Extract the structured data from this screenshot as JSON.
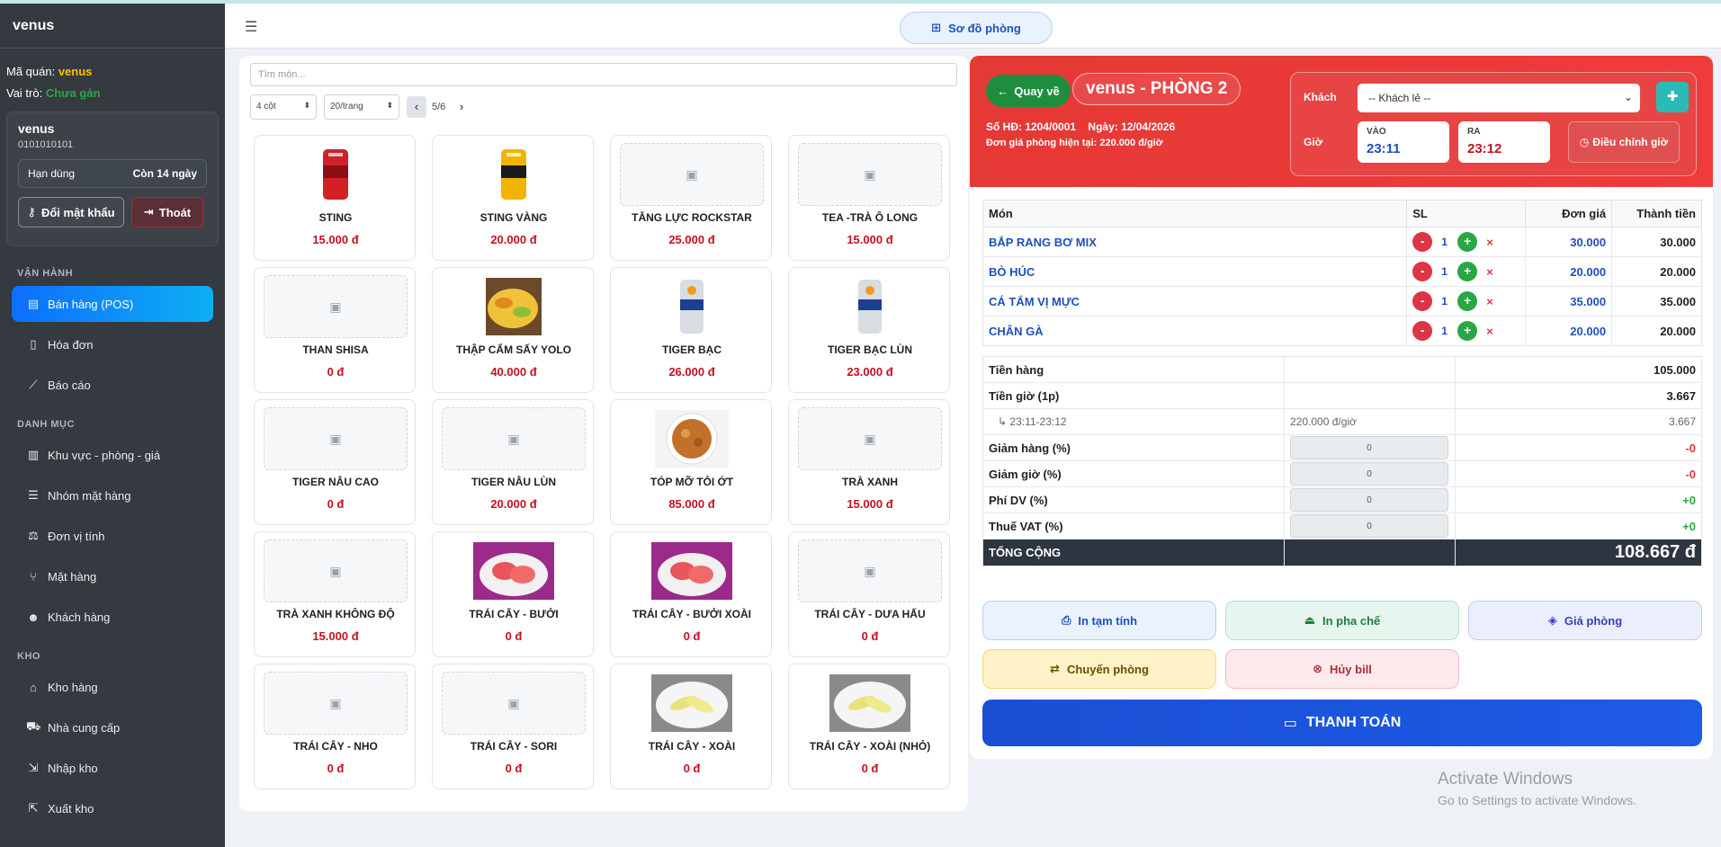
{
  "sidebar": {
    "brand": "venus",
    "shop_code_label": "Mã quán:",
    "shop_code": "venus",
    "role_label": "Vai trò:",
    "role": "Chưa gán",
    "account": {
      "name": "venus",
      "code": "0101010101",
      "expiry_label": "Hạn dùng",
      "expiry_value": "Còn 14 ngày",
      "change_password": "Đổi mật khẩu",
      "logout": "Thoát"
    },
    "sections": [
      {
        "title": "VẬN HÀNH",
        "items": [
          {
            "label": "Bán hàng (POS)",
            "icon": "cash-register-icon",
            "active": true
          },
          {
            "label": "Hóa đơn",
            "icon": "invoice-icon"
          },
          {
            "label": "Báo cáo",
            "icon": "chart-line-icon"
          }
        ]
      },
      {
        "title": "DANH MỤC",
        "items": [
          {
            "label": "Khu vực - phòng - giá",
            "icon": "building-icon"
          },
          {
            "label": "Nhóm mặt hàng",
            "icon": "list-icon"
          },
          {
            "label": "Đơn vị tính",
            "icon": "scale-icon"
          },
          {
            "label": "Mặt hàng",
            "icon": "utensils-icon"
          },
          {
            "label": "Khách hàng",
            "icon": "users-icon"
          }
        ]
      },
      {
        "title": "KHO",
        "items": [
          {
            "label": "Kho hàng",
            "icon": "warehouse-icon"
          },
          {
            "label": "Nhà cung cấp",
            "icon": "truck-icon"
          },
          {
            "label": "Nhập kho",
            "icon": "import-icon"
          },
          {
            "label": "Xuất kho",
            "icon": "export-icon"
          }
        ]
      }
    ]
  },
  "topbar": {
    "room_map": "Sơ đồ phòng"
  },
  "products": {
    "search_placeholder": "Tìm món...",
    "columns_select": "4 cột",
    "per_page_select": "20/trang",
    "page_indicator": "5/6",
    "items": [
      {
        "name": "STING",
        "price": "15.000 đ",
        "image": "sting-can"
      },
      {
        "name": "STING VÀNG",
        "price": "20.000 đ",
        "image": "sting-gold-can"
      },
      {
        "name": "TĂNG LỰC ROCKSTAR",
        "price": "25.000 đ",
        "image": ""
      },
      {
        "name": "TEA -TRÀ Ô LONG",
        "price": "15.000 đ",
        "image": ""
      },
      {
        "name": "THAN SHISA",
        "price": "0 đ",
        "image": ""
      },
      {
        "name": "THẬP CẨM SẤY YOLO",
        "price": "40.000 đ",
        "image": "dried-fruit"
      },
      {
        "name": "TIGER BẠC",
        "price": "26.000 đ",
        "image": "tiger-can"
      },
      {
        "name": "TIGER BẠC LÙN",
        "price": "23.000 đ",
        "image": "tiger-can"
      },
      {
        "name": "TIGER NÂU CAO",
        "price": "0 đ",
        "image": ""
      },
      {
        "name": "TIGER NÂU LÙN",
        "price": "20.000 đ",
        "image": ""
      },
      {
        "name": "TÓP MỠ TỎI ỚT",
        "price": "85.000 đ",
        "image": "pork-crackling"
      },
      {
        "name": "TRÀ XANH",
        "price": "15.000 đ",
        "image": ""
      },
      {
        "name": "TRÀ XANH KHÔNG ĐỘ",
        "price": "15.000 đ",
        "image": ""
      },
      {
        "name": "TRÁI CÂY - BƯỞI",
        "price": "0 đ",
        "image": "pomelo"
      },
      {
        "name": "TRÁI CÂY - BƯỞI XOÀI",
        "price": "0 đ",
        "image": "pomelo"
      },
      {
        "name": "TRÁI CÂY - DƯA HẤU",
        "price": "0 đ",
        "image": ""
      },
      {
        "name": "TRÁI CÂY - NHO",
        "price": "0 đ",
        "image": ""
      },
      {
        "name": "TRÁI CÂY - SORI",
        "price": "0 đ",
        "image": ""
      },
      {
        "name": "TRÁI CÂY - XOÀI",
        "price": "0 đ",
        "image": "mango"
      },
      {
        "name": "TRÁI CÂY - XOÀI (NHỎ)",
        "price": "0 đ",
        "image": "mango"
      }
    ]
  },
  "order": {
    "back": "Quay về",
    "room_title": "venus - PHÒNG 2",
    "bill_no": "Số HĐ: 1204/0001",
    "date": "Ngày: 12/04/2026",
    "rate": "Đơn giá phòng hiện tại: 220.000 đ/giờ",
    "customer_label": "Khách",
    "customer_select": "-- Khách lẻ --",
    "time_label": "Giờ",
    "in_label": "VÀO",
    "in_time": "23:11",
    "out_label": "RA",
    "out_time": "23:12",
    "adjust": "Điều chỉnh giờ",
    "headers": {
      "item": "Món",
      "qty": "SL",
      "price": "Đơn giá",
      "total": "Thành tiền"
    },
    "lines": [
      {
        "item": "BẮP RANG BƠ MIX",
        "qty": "1",
        "price": "30.000",
        "total": "30.000"
      },
      {
        "item": "BÒ HÚC",
        "qty": "1",
        "price": "20.000",
        "total": "20.000"
      },
      {
        "item": "CÁ TẨM VỊ MỰC",
        "qty": "1",
        "price": "35.000",
        "total": "35.000"
      },
      {
        "item": "CHÂN GÀ",
        "qty": "1",
        "price": "20.000",
        "total": "20.000"
      }
    ],
    "summary": {
      "goods_label": "Tiền hàng",
      "goods": "105.000",
      "time_label": "Tiền giờ (1p)",
      "time": "3.667",
      "time_detail": "↳ 23:11-23:12",
      "time_rate": "220.000 đ/giờ",
      "time_detail_val": "3.667",
      "disc_goods_label": "Giảm hàng (%)",
      "disc_goods_input": "0",
      "disc_goods": "-0",
      "disc_time_label": "Giảm giờ (%)",
      "disc_time_input": "0",
      "disc_time": "-0",
      "service_label": "Phí DV (%)",
      "service_input": "0",
      "service": "+0",
      "vat_label": "Thuế VAT (%)",
      "vat_input": "0",
      "vat": "+0",
      "grand_label": "TỔNG CỘNG",
      "grand": "108.667 đ"
    },
    "actions": {
      "print_temp": "In tạm tính",
      "print_bar": "In pha chế",
      "room_price": "Giá phòng",
      "move_room": "Chuyển phòng",
      "cancel_bill": "Hủy bill",
      "pay": "THANH TOÁN"
    }
  },
  "watermark": {
    "line1": "Activate Windows",
    "line2": "Go to Settings to activate Windows."
  }
}
